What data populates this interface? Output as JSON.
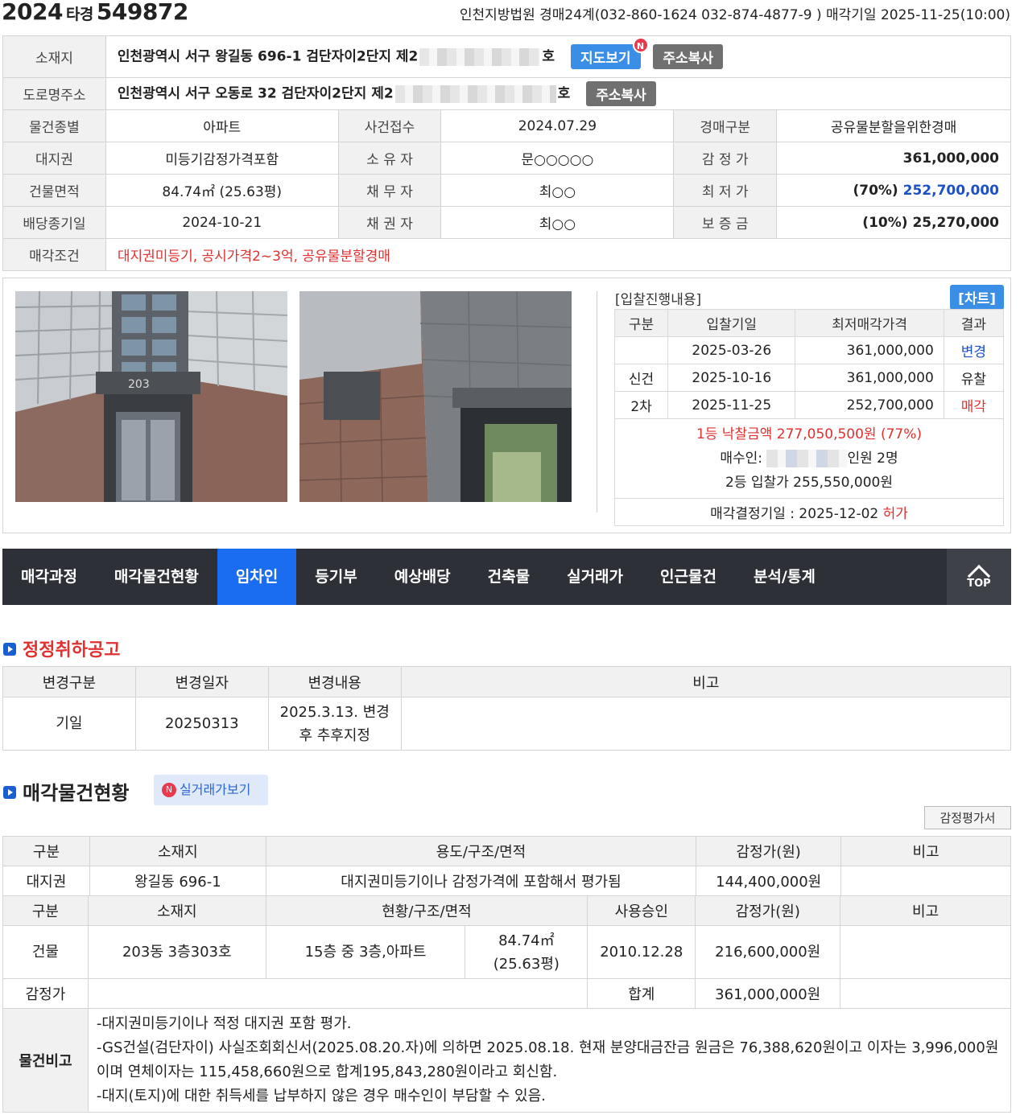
{
  "header": {
    "year": "2024",
    "type": "타경",
    "number": "549872",
    "court_info": "인천지방법원 경매24계(032-860-1624 032-874-4877-9 ) 매각기일 2025-11-25(10:00)"
  },
  "info": {
    "address_label": "소재지",
    "address_value": "인천광역시 서구 왕길동 696-1 검단자이2단지 제2",
    "address_suffix": "호",
    "map_button": "지도보기",
    "map_badge": "N",
    "copy_button": "주소복사",
    "road_label": "도로명주소",
    "road_value": "인천광역시 서구 오동로 32 검단자이2단지 제2",
    "road_suffix": "호",
    "road_copy_button": "주소복사",
    "rows": [
      {
        "l1": "물건종별",
        "v1": "아파트",
        "l2": "사건접수",
        "v2": "2024.07.29",
        "l3": "경매구분",
        "v3": "공유물분할을위한경매"
      },
      {
        "l1": "대지권",
        "v1": "미등기감정가격포함",
        "l2": "소 유 자",
        "v2": "문○○○○○",
        "l3": "감 정 가",
        "v3": "361,000,000"
      },
      {
        "l1": "건물면적",
        "v1": "84.74㎡ (25.63평)",
        "l2": "채 무 자",
        "v2": "최○○",
        "l3": "최 저 가",
        "v3_pct": "(70%)",
        "v3": "252,700,000"
      },
      {
        "l1": "배당종기일",
        "v1": "2024-10-21",
        "l2": "채 권 자",
        "v2": "최○○",
        "l3": "보 증 금",
        "v3": "(10%) 25,270,000"
      }
    ],
    "cond_label": "매각조건",
    "cond_value": "대지권미등기, 공시가격2~3억, 공유물분할경매"
  },
  "bid": {
    "title": "[입찰진행내용]",
    "chart_button": "[차트]",
    "headers": [
      "구분",
      "입찰기일",
      "최저매각가격",
      "결과"
    ],
    "rows": [
      {
        "type": "",
        "date": "2025-03-26",
        "price": "361,000,000",
        "result": "변경"
      },
      {
        "type": "신건",
        "date": "2025-10-16",
        "price": "361,000,000",
        "result": "유찰"
      },
      {
        "type": "2차",
        "date": "2025-11-25",
        "price": "252,700,000",
        "result": "매각"
      }
    ],
    "winning": "1등 낙찰금액 277,050,500원 (77%)",
    "buyer_prefix": "매수인:",
    "buyer_suffix": "인원 2명",
    "second": "2등 입찰가 255,550,000원",
    "decision_prefix": "매각결정기일 : 2025-12-02",
    "decision_result": "허가"
  },
  "photos": {
    "photo1_sign": "203",
    "photo1_alt": "apartment-entrance-photo",
    "photo2_alt": "apartment-wall-photo"
  },
  "nav": {
    "items": [
      "매각과정",
      "매각물건현황",
      "임차인",
      "등기부",
      "예상배당",
      "건축물",
      "실거래가",
      "인근물건",
      "분석/통계"
    ],
    "active_index": 2,
    "top_label": "TOP"
  },
  "correction": {
    "title": "정정취하공고",
    "headers": [
      "변경구분",
      "변경일자",
      "변경내용",
      "비고"
    ],
    "row": {
      "kind": "기일",
      "date": "20250313",
      "content_1": "2025.3.13. 변경",
      "content_2": "후 추후지정",
      "note": ""
    }
  },
  "property": {
    "title": "매각물건현황",
    "real_price_button": "실거래가보기",
    "real_price_badge": "N",
    "appraisal_button": "감정평가서",
    "land_headers": [
      "구분",
      "소재지",
      "용도/구조/면적",
      "감정가(원)",
      "비고"
    ],
    "land_row": {
      "kind": "대지권",
      "loc": "왕길동 696-1",
      "usage": "대지권미등기이나 감정가격에 포함해서 평가됨",
      "price": "144,400,000원",
      "note": ""
    },
    "bldg_headers": [
      "구분",
      "소재지",
      "현황/구조/면적",
      "사용승인",
      "감정가(원)",
      "비고"
    ],
    "bldg_row": {
      "kind": "건물",
      "loc": "203동 3층303호",
      "structure": "15층 중 3층,아파트",
      "area_1": "84.74㎡",
      "area_2": "(25.63평)",
      "approval": "2010.12.28",
      "price": "216,600,000원",
      "note": ""
    },
    "sum_row": {
      "label": "감정가",
      "total_label": "합계",
      "total": "361,000,000원"
    },
    "remark_label": "물건비고",
    "remarks": [
      "-대지권미등기이나 적정 대지권 포함 평가.",
      "-GS건설(검단자이) 사실조회회신서(2025.08.20.자)에 의하면 2025.08.18. 현재 분양대금잔금 원금은 76,388,620원이고 이자는 3,996,000원이며 연체이자는 115,458,660원으로 합계195,843,280원이라고 회신함.",
      "-대지(토지)에 대한 취득세를 납부하지 않은 경우 매수인이 부담할 수 있음."
    ]
  },
  "colors": {
    "accent_blue": "#1a6df0",
    "nav_bg": "#2d3036",
    "red": "#e03030",
    "link_blue": "#1a50c8"
  }
}
